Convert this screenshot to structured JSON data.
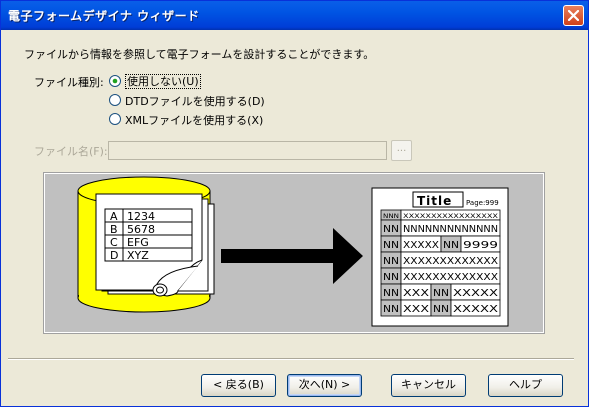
{
  "window": {
    "title": "電子フォームデザイナ ウィザード"
  },
  "intro_text": "ファイルから情報を参照して電子フォームを設計することができます。",
  "file_type": {
    "label": "ファイル種別:",
    "options": [
      {
        "label": "使用しない(U)",
        "selected": true
      },
      {
        "label": "DTDファイルを使用する(D)",
        "selected": false
      },
      {
        "label": "XMLファイルを使用する(X)",
        "selected": false
      }
    ]
  },
  "file_name": {
    "label": "ファイル名(F):",
    "value": "",
    "browse_label": "..."
  },
  "illustration": {
    "db_rows": [
      {
        "key": "A",
        "value": "1234"
      },
      {
        "key": "B",
        "value": "5678"
      },
      {
        "key": "C",
        "value": "EFG"
      },
      {
        "key": "D",
        "value": "XYZ"
      }
    ],
    "form": {
      "title": "Title",
      "page": "Page:999",
      "rows": [
        [
          "NNN",
          "XXXXXXXXXXXXXXXXX"
        ],
        [
          "NN",
          "NNNNNNNNNNNNN"
        ],
        [
          "NN",
          "XXXXX",
          "NN",
          "9999"
        ],
        [
          "NN",
          "XXXXXXXXXXXXX"
        ],
        [
          "NN",
          "XXXXXXXXXXXXX"
        ],
        [
          "NN",
          "XXX",
          "NN",
          "XXXXX"
        ],
        [
          "NN",
          "XXX",
          "NN",
          "XXXXX"
        ]
      ]
    }
  },
  "buttons": {
    "back": "< 戻る(B)",
    "next": "次へ(N) >",
    "cancel": "キャンセル",
    "help": "ヘルプ"
  },
  "colors": {
    "titlebar": "#0054e3",
    "cylinder": "#ffff00",
    "background": "#ece9d8"
  }
}
